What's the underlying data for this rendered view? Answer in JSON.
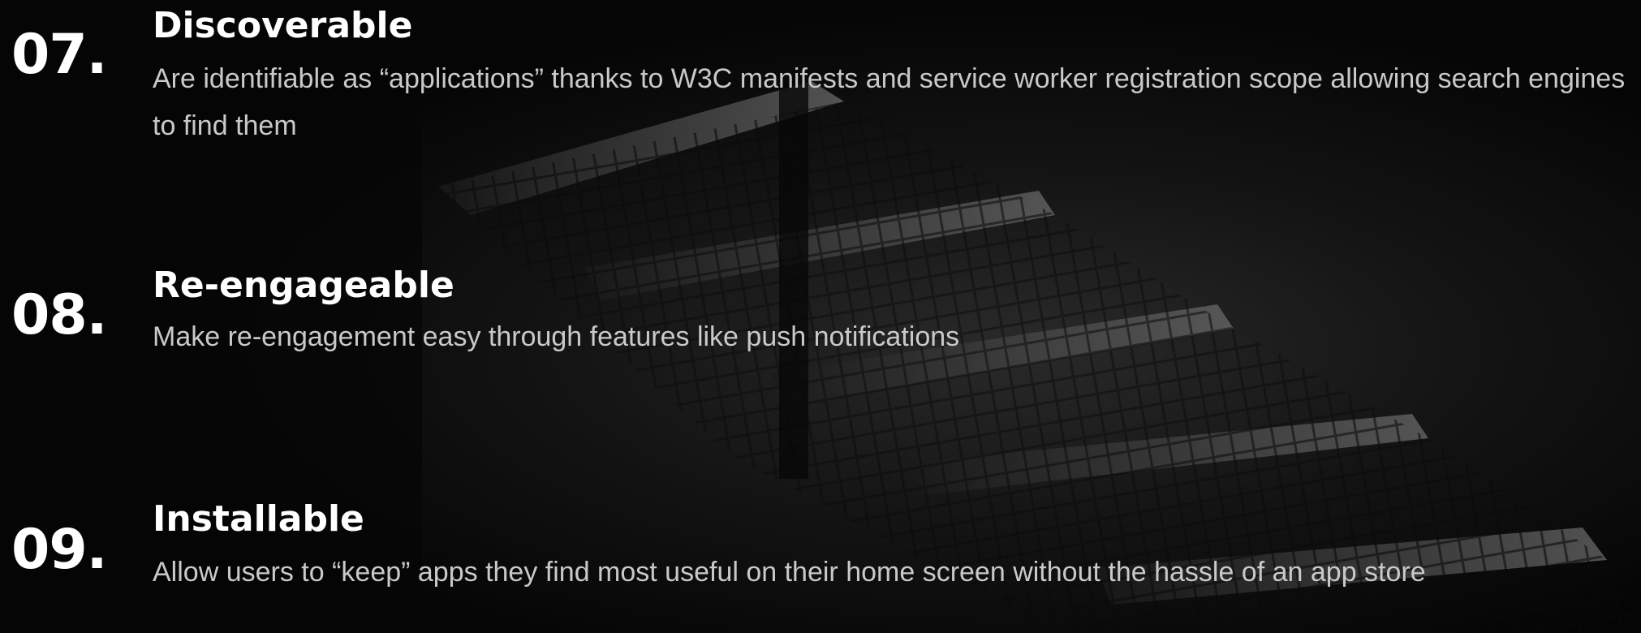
{
  "features": [
    {
      "number": "07.",
      "title": "Discoverable",
      "description": "Are identifiable as “applications” thanks to W3C manifests and service worker registration scope allowing search engines to find them"
    },
    {
      "number": "08.",
      "title": "Re-engageable",
      "description": "Make re-engagement easy through features like push notifications"
    },
    {
      "number": "09.",
      "title": "Installable",
      "description": "Allow users to “keep” apps they find most useful on their home screen without the hassle of an app store"
    }
  ],
  "background": {
    "base_color": "#050505",
    "image": "dark-stairs-photo"
  }
}
